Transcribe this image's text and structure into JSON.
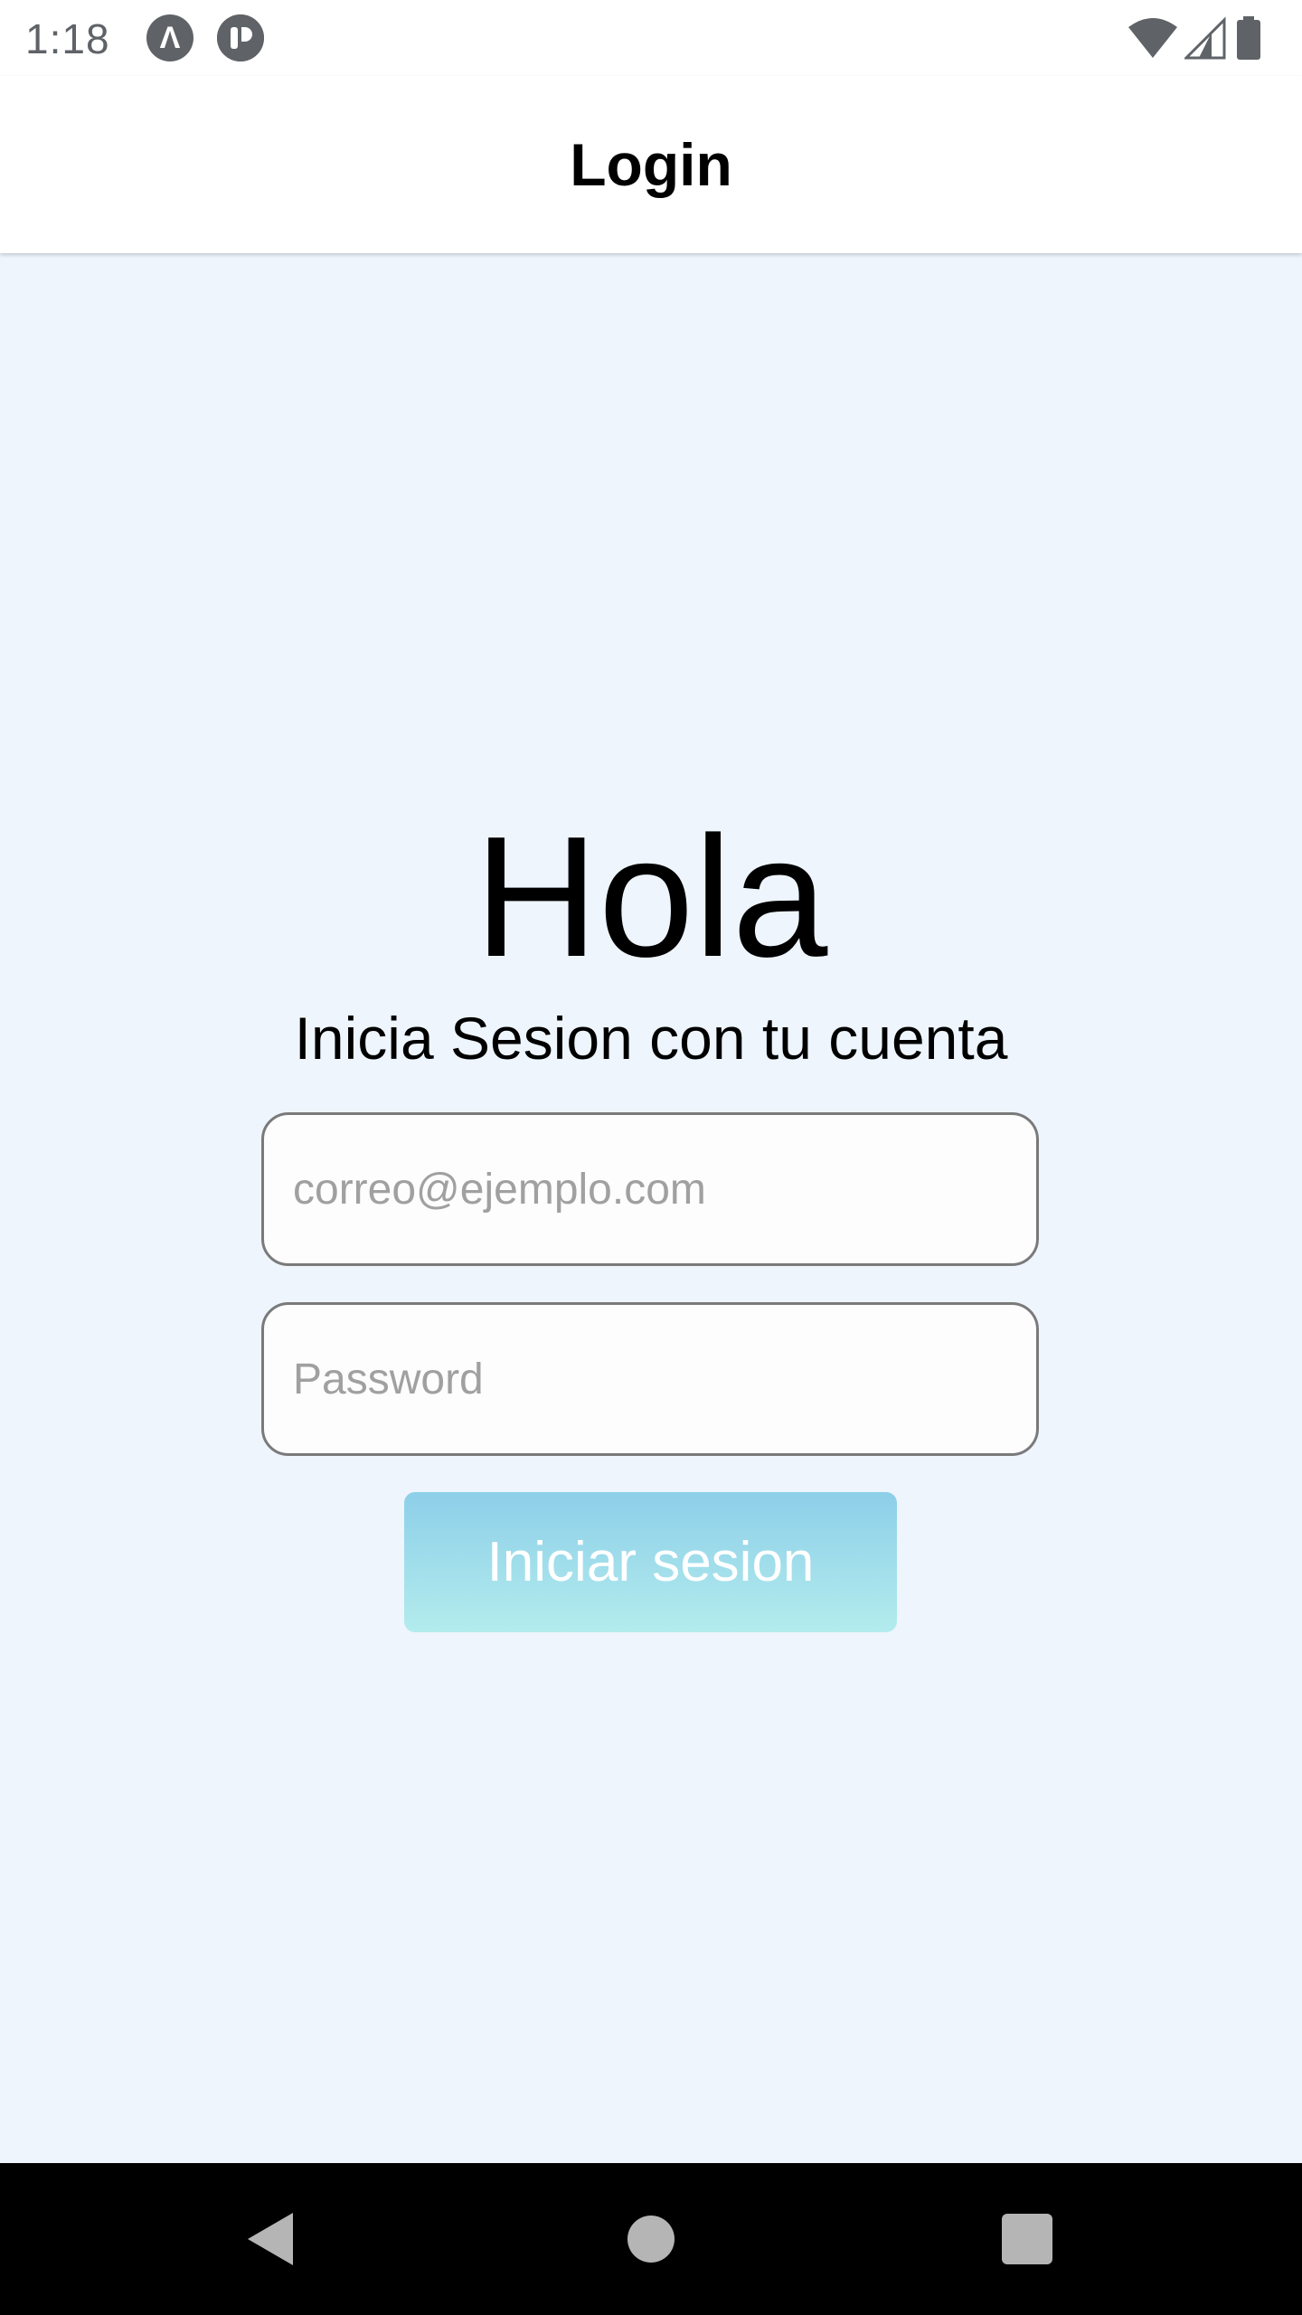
{
  "status_bar": {
    "time": "1:18",
    "notification_icons": [
      "expo-icon",
      "app-notification-icon"
    ],
    "system_icons": [
      "wifi-icon",
      "cellular-signal-icon",
      "battery-icon"
    ]
  },
  "header": {
    "title": "Login"
  },
  "main": {
    "greeting": "Hola",
    "subtitle": "Inicia Sesion con tu cuenta",
    "email_field": {
      "value": "",
      "placeholder": "correo@ejemplo.com"
    },
    "password_field": {
      "value": "",
      "placeholder": "Password"
    },
    "login_button_label": "Iniciar sesion"
  },
  "nav_bar": {
    "buttons": [
      "back-icon",
      "home-icon",
      "recents-icon"
    ]
  },
  "colors": {
    "background": "#eef5fd",
    "button_gradient_top": "#8dcfe9",
    "button_gradient_bottom": "#b3eced",
    "field_border": "#7a7a7a"
  }
}
